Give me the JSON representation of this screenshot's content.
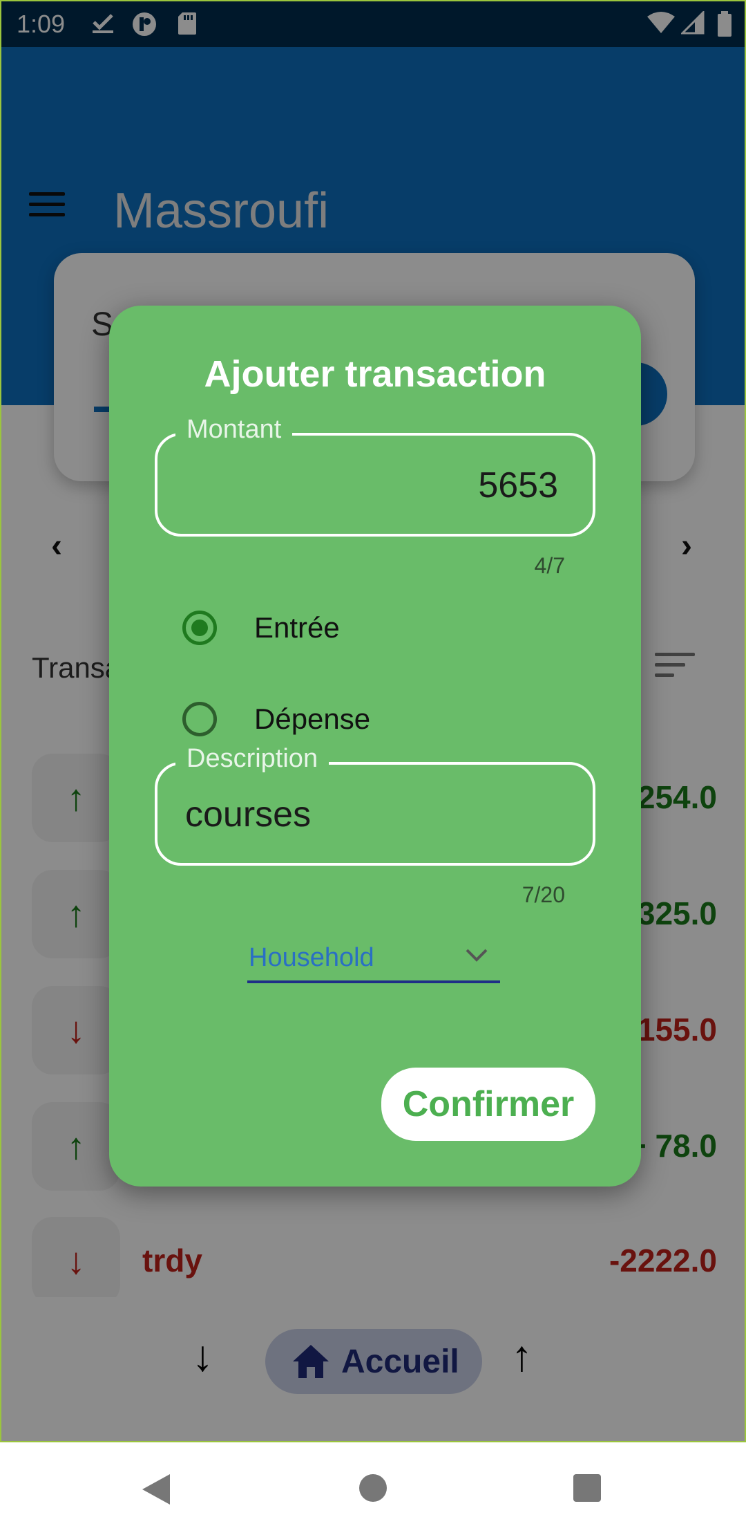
{
  "status_bar": {
    "time": "1:09"
  },
  "app": {
    "title": "Massroufi"
  },
  "balance_card": {
    "label": "S"
  },
  "section": {
    "title": "Transa"
  },
  "transactions": [
    {
      "name": "",
      "amount": "254.0",
      "type": "income"
    },
    {
      "name": "",
      "amount": "325.0",
      "type": "income"
    },
    {
      "name": "",
      "amount": "155.0",
      "type": "expense"
    },
    {
      "name": "",
      "amount": "+ 78.0",
      "type": "income"
    },
    {
      "name": "trdy",
      "amount": "-2222.0",
      "type": "expense"
    }
  ],
  "bottom_nav": {
    "home_label": "Accueil"
  },
  "dialog": {
    "title": "Ajouter transaction",
    "amount_label": "Montant",
    "amount_value": "5653",
    "amount_counter": "4/7",
    "radio_income": "Entrée",
    "radio_expense": "Dépense",
    "selected_type": "income",
    "description_label": "Description",
    "description_value": "courses",
    "description_counter": "7/20",
    "category_value": "Household",
    "confirm_label": "Confirmer"
  },
  "colors": {
    "appbar": "#0d6fbf",
    "dialog": "#69bc69",
    "income": "#1b7a1b",
    "expense": "#c0211b"
  }
}
